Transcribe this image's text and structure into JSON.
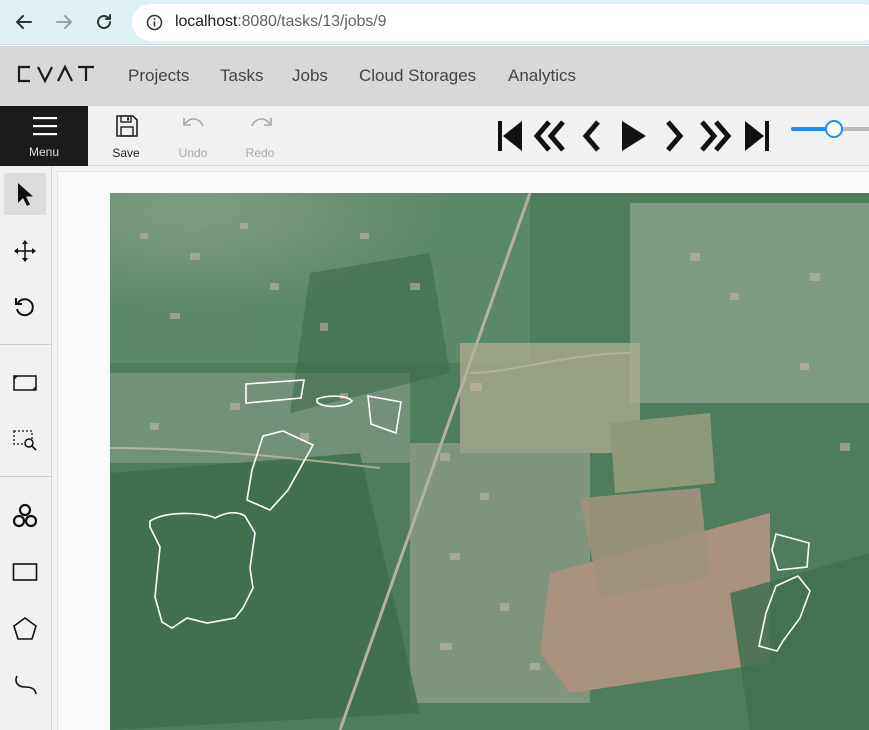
{
  "browser": {
    "url_host": "localhost",
    "url_path": ":8080/tasks/13/jobs/9"
  },
  "header": {
    "logo": "CVAT",
    "links": [
      "Projects",
      "Tasks",
      "Jobs",
      "Cloud Storages",
      "Analytics"
    ]
  },
  "toolbar": {
    "menu_label": "Menu",
    "save_label": "Save",
    "undo_label": "Undo",
    "redo_label": "Redo",
    "player_buttons": [
      "first-frame-icon",
      "previous-step-icon",
      "previous-frame-icon",
      "play-icon",
      "next-frame-icon",
      "next-step-icon",
      "last-frame-icon"
    ],
    "playback_speed_fraction": 0.45
  },
  "sidebar": {
    "tools": [
      "cursor-icon",
      "move-icon",
      "rotate-icon",
      "fit-image-icon",
      "zoom-region-icon",
      "opencv-icon",
      "rectangle-icon",
      "polygon-icon",
      "polyline-icon"
    ],
    "active_tool": "cursor-icon"
  },
  "annotations": {
    "shape_type": "polygon",
    "count": 8,
    "stroke_color": "#ffffff"
  },
  "colors": {
    "browser_bar": "#dff1f4",
    "header_bg": "#d8d8d8",
    "toolbar_bg": "#f1f1f1",
    "menu_bg": "#1b1b1b",
    "accent": "#1890ff"
  }
}
